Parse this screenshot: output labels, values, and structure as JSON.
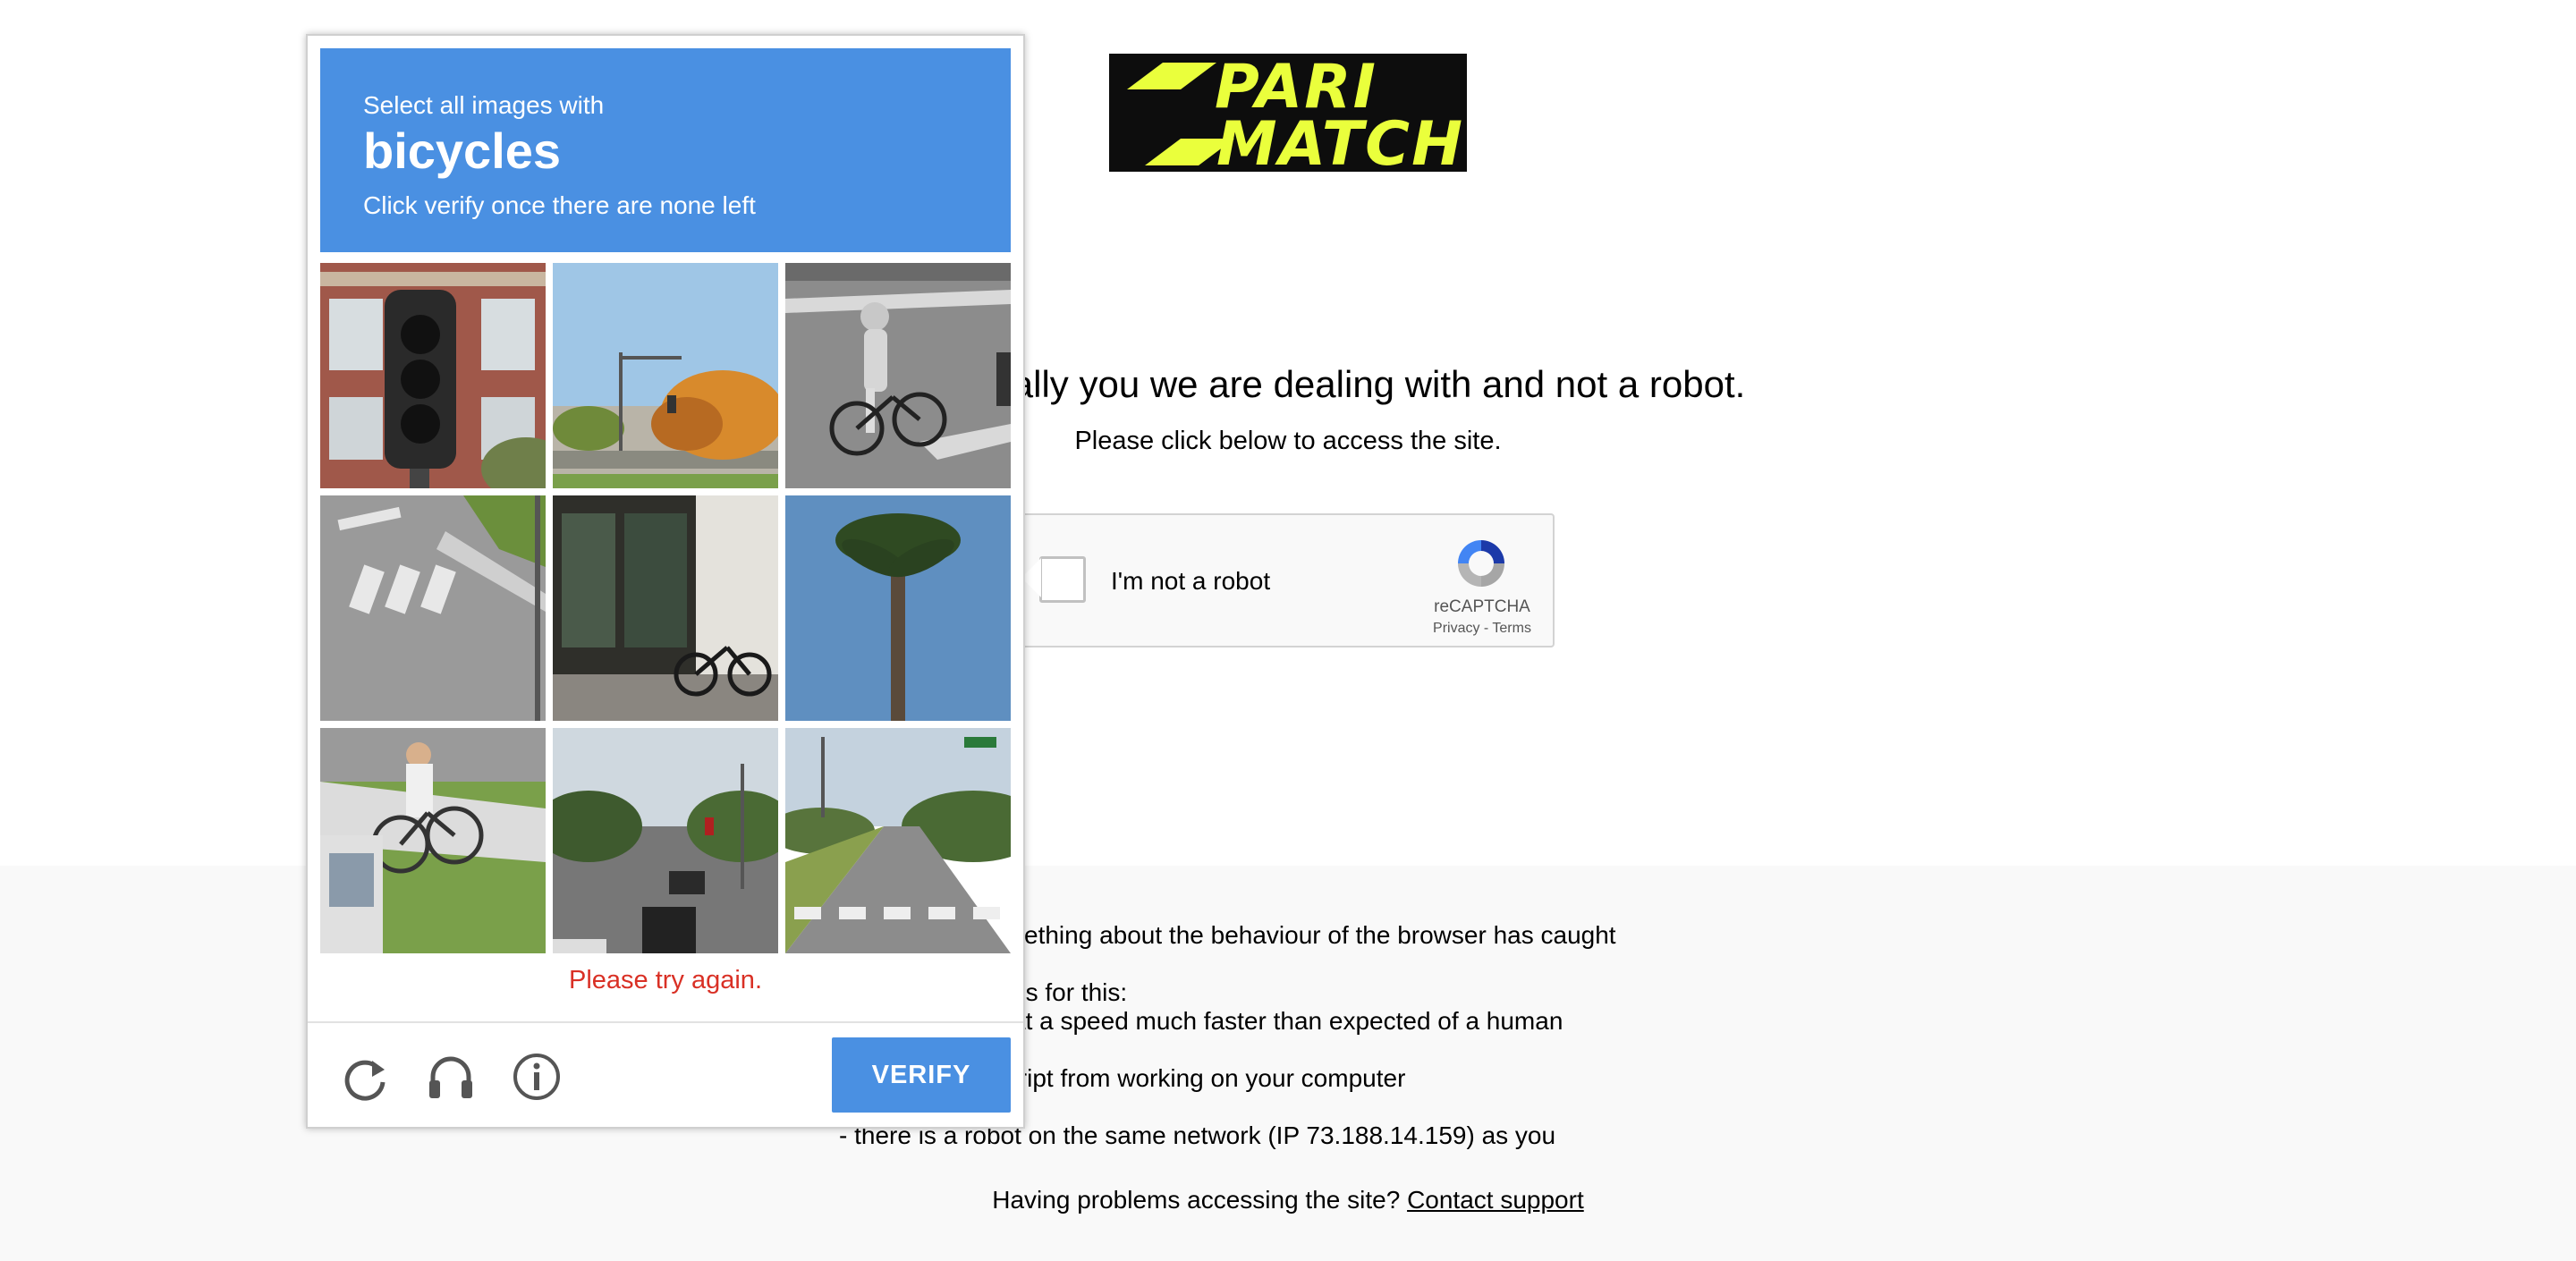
{
  "logo": {
    "line1": "PARI",
    "line2": "MATCH",
    "background": "#0d0d0d",
    "text_color": "#eaff3c"
  },
  "main": {
    "headline": "re it is actually you we are dealing with and not a robot.",
    "subline": "Please click below to access the site."
  },
  "recaptcha": {
    "label": "I'm not a robot",
    "brand": "reCAPTCHA",
    "privacy": "Privacy",
    "separator": " - ",
    "terms": "Terms"
  },
  "explanation": {
    "line1": "n required? Something about the behaviour of the browser has caught",
    "line2": "sible explanations for this:",
    "line3": "ng and clicking at a speed much faster than expected of a human",
    "line4": "eventing Javascript from working on your computer",
    "line5": "- there is a robot on the same network (IP 73.188.14.159) as you"
  },
  "support": {
    "prefix": "Having problems accessing the site? ",
    "link": "Contact support"
  },
  "challenge": {
    "instruction": "Select all images with",
    "target": "bicycles",
    "hint": "Click verify once there are none left",
    "error": "Please try again.",
    "verify_label": "VERIFY",
    "header_color": "#4a90e2",
    "error_color": "#d93025",
    "tiles": [
      {
        "icon": "traffic-light-image"
      },
      {
        "icon": "intersection-trees-image"
      },
      {
        "icon": "cyclist-road-image"
      },
      {
        "icon": "crosswalk-image"
      },
      {
        "icon": "storefront-bicycle-image"
      },
      {
        "icon": "palm-tree-image"
      },
      {
        "icon": "cyclist-sidewalk-image"
      },
      {
        "icon": "street-traffic-image"
      },
      {
        "icon": "road-crosswalk-image"
      }
    ],
    "tools": [
      {
        "icon": "reload-icon"
      },
      {
        "icon": "audio-headphones-icon"
      },
      {
        "icon": "info-icon"
      }
    ]
  }
}
